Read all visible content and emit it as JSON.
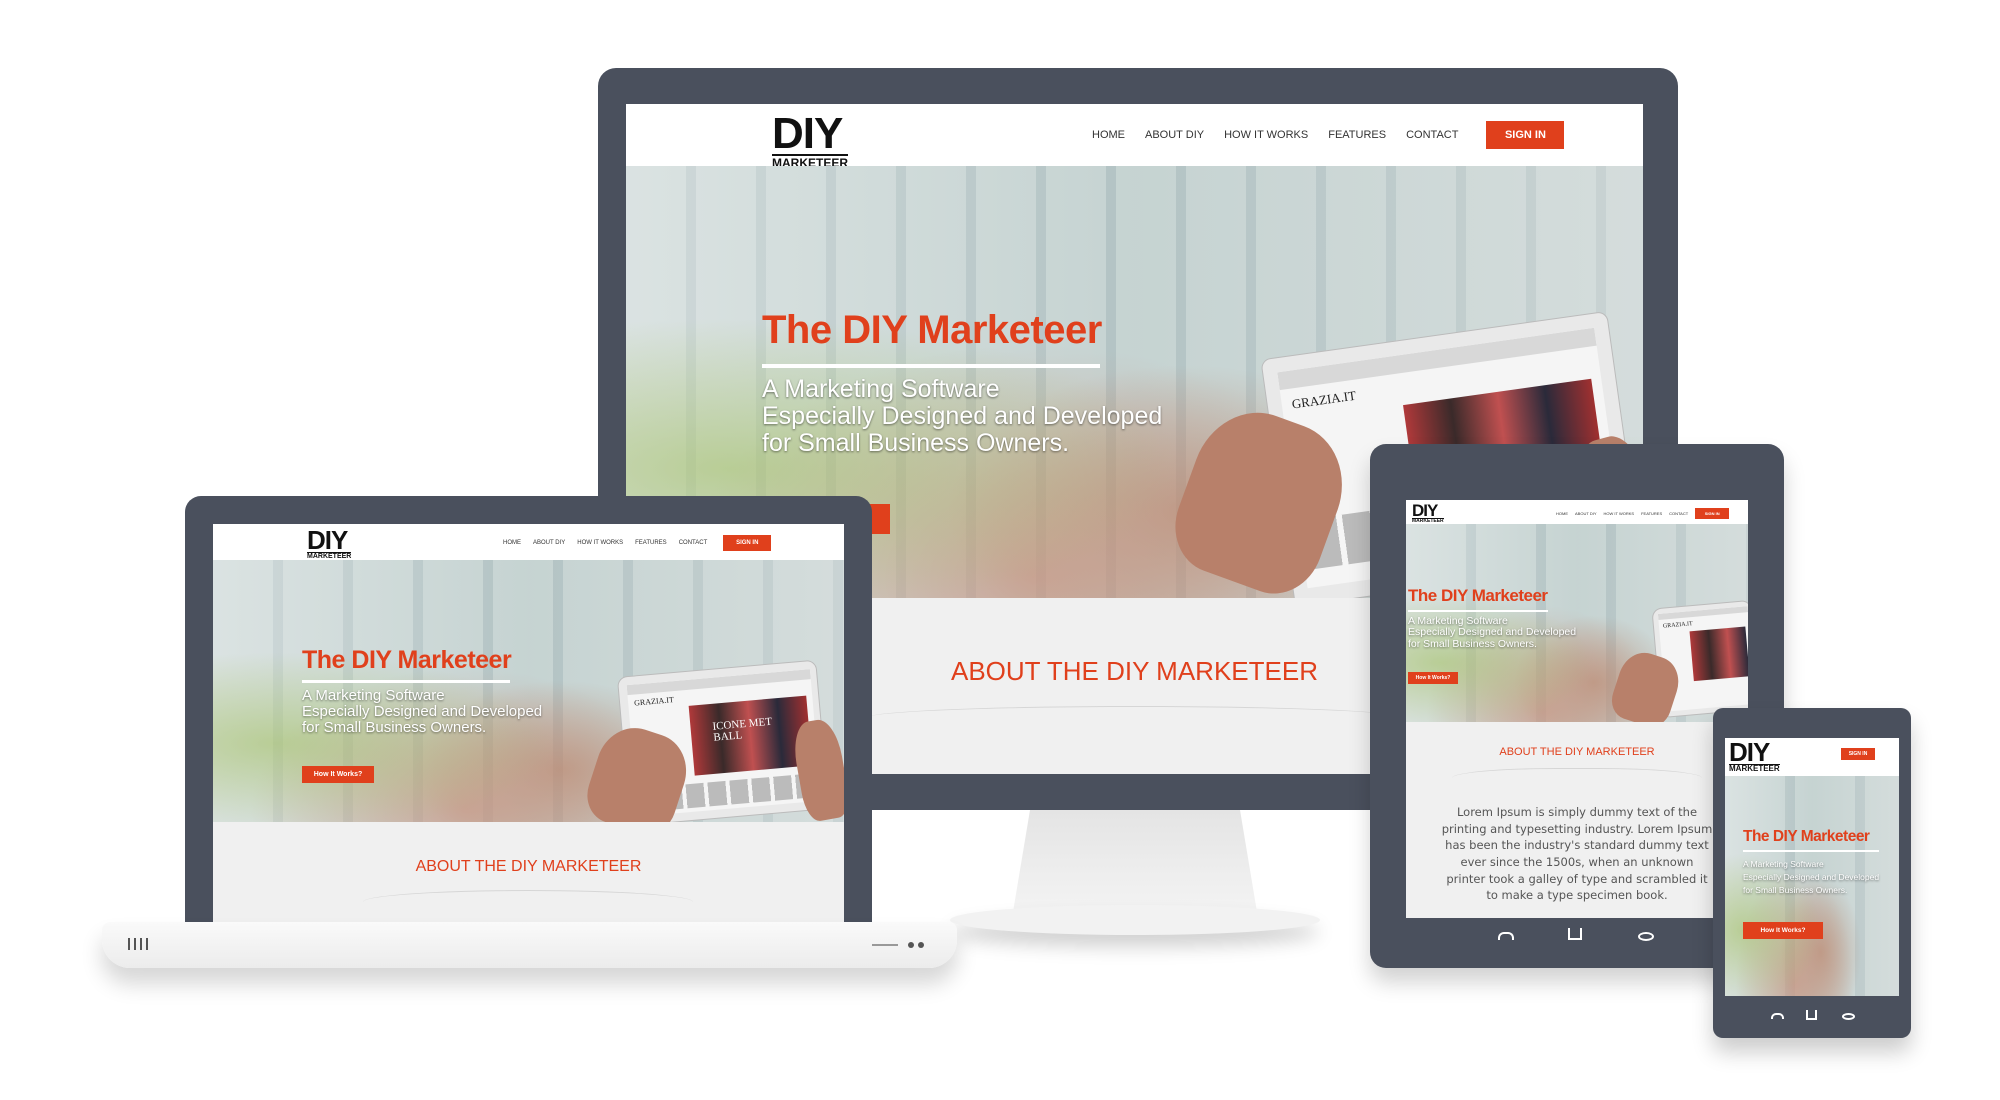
{
  "brand": {
    "logo_main": "DIY",
    "logo_sub": "MARKETEER",
    "accent": "#e0401c",
    "device_frame": "#4a505d"
  },
  "nav": {
    "items": [
      "HOME",
      "ABOUT DIY",
      "HOW IT WORKS",
      "FEATURES",
      "CONTACT"
    ],
    "sign_in": "SIGN IN"
  },
  "hero": {
    "title": "The DIY Marketeer",
    "subtitle_lines": [
      "A Marketing Software",
      "Especially Designed and Developed",
      "for Small Business Owners."
    ],
    "button": "How It Works?"
  },
  "about": {
    "title": "ABOUT THE DIY MARKETEER",
    "body": "Lorem Ipsum is simply dummy text of the printing and typesetting industry. Lorem Ipsum has been the industry's standard dummy text ever since the 1500s, when an unknown printer took a galley of type and scrambled it to make a type specimen book."
  },
  "prop_tablet": {
    "site_name": "GRAZIA.IT",
    "banner": "ICONE MET BALL"
  },
  "icons": {
    "laptop_left": "vent-lines-icon",
    "laptop_right": "indicator-lights-icon",
    "android_back": "back-icon",
    "android_home": "home-icon",
    "android_recent": "recent-apps-icon"
  }
}
